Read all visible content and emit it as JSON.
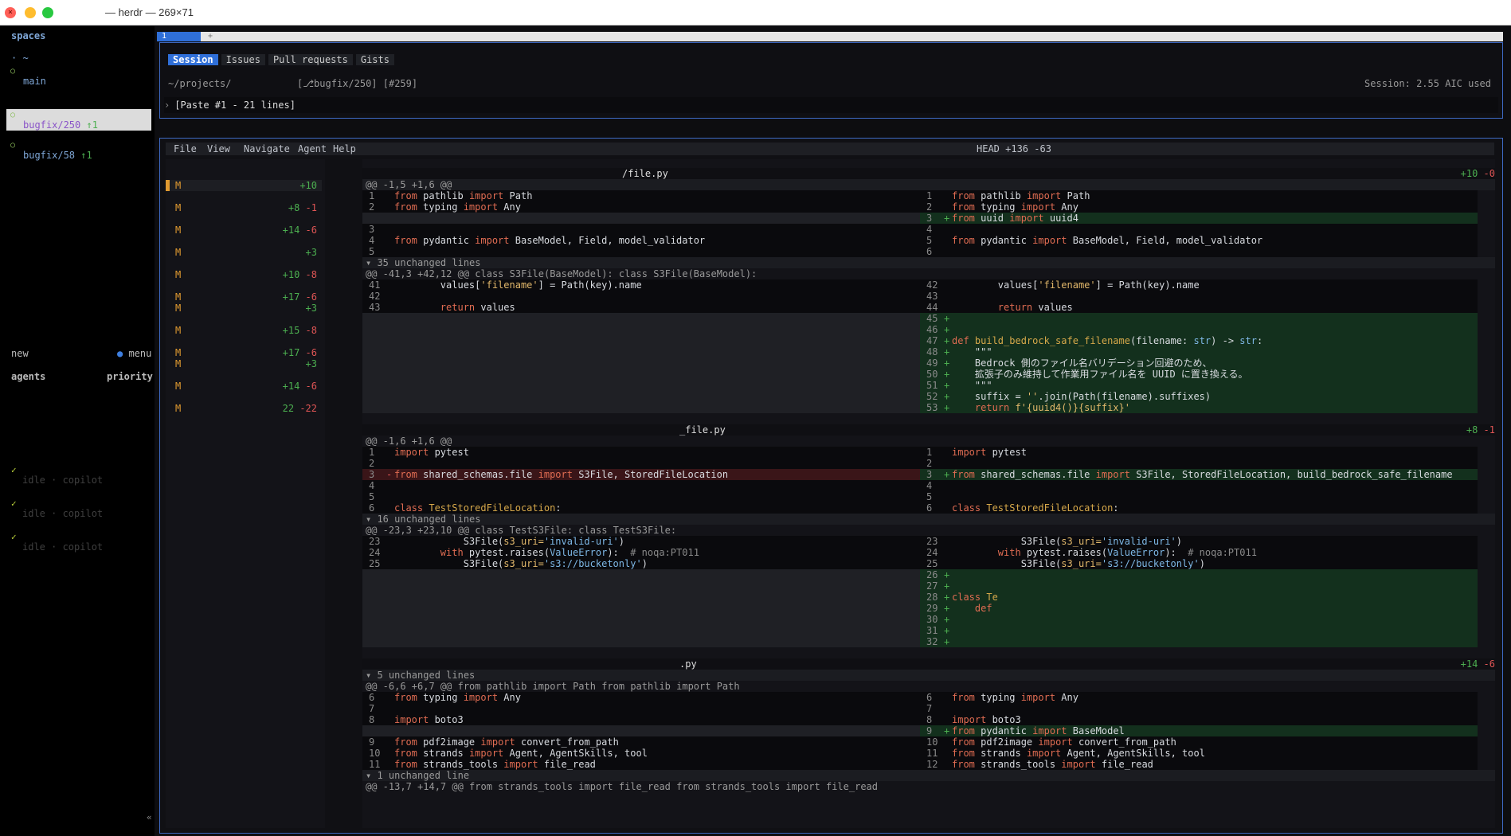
{
  "window": {
    "title": "— herdr — 269×71",
    "close_glyph": "×"
  },
  "sidebar": {
    "spaces_label": "spaces",
    "home": "· ~",
    "circle": "○",
    "items": [
      {
        "name": "main",
        "ahead": ""
      },
      {
        "name": "bugfix/250",
        "ahead": "↑1"
      },
      {
        "name": "bugfix/58",
        "ahead": "↑1"
      }
    ],
    "new_label": "new",
    "menu_label": "● menu",
    "agents_label": "agents",
    "priority_label": "priority",
    "check": "✓",
    "agents": [
      {
        "status": "idle · copilot"
      },
      {
        "status": "idle · copilot"
      },
      {
        "status": "idle · copilot"
      }
    ],
    "collapse": "«"
  },
  "tabs": {
    "active": "1",
    "plus": "+"
  },
  "session": {
    "tabs": [
      "Session",
      "Issues",
      "Pull requests",
      "Gists"
    ],
    "path": "~/projects/",
    "branch": "[⎇bugfix/250] [#259]",
    "usage": "Session: 2.55 AIC used",
    "prompt_marker": "›",
    "prompt": "[Paste #1 - 21 lines]"
  },
  "menu": {
    "items": [
      "File",
      "View",
      "Navigate",
      "Agent",
      "Help"
    ],
    "head": "HEAD  +136  -63"
  },
  "files": [
    {
      "status": "M",
      "add": "+10",
      "del": ""
    },
    {
      "status": "M",
      "add": "+8",
      "del": "-1"
    },
    {
      "status": "M",
      "add": "+14",
      "del": "-6"
    },
    {
      "status": "M",
      "add": "+3",
      "del": ""
    },
    {
      "status": "M",
      "add": "+10",
      "del": "-8"
    },
    {
      "status": "M",
      "add": "+17",
      "del": "-6"
    },
    {
      "status": "M",
      "add": "+3",
      "del": ""
    },
    {
      "status": "M",
      "add": "+15",
      "del": "-8"
    },
    {
      "status": "M",
      "add": "+17",
      "del": "-6"
    },
    {
      "status": "M",
      "add": "+3",
      "del": ""
    },
    {
      "status": "M",
      "add": "+14",
      "del": "-6"
    },
    {
      "status": "M",
      "add": "22",
      "del": "-22"
    }
  ],
  "diff": {
    "file1": {
      "name": "/file.py",
      "add": "+10",
      "del": "-0",
      "hunk1": "@@ -1,5 +1,6 @@",
      "unchanged1": "▾ 35 unchanged lines",
      "hunk2": "@@ -41,3 +42,12 @@ class S3File(BaseModel): class S3File(BaseModel):"
    },
    "file2": {
      "name": "_file.py",
      "add": "+8",
      "del": "-1",
      "hunk1": "@@ -1,6 +1,6 @@",
      "unchanged1": "▾ 16 unchanged lines",
      "hunk2": "@@ -23,3 +23,10 @@ class TestS3File: class TestS3File:"
    },
    "file3": {
      "name": ".py",
      "add": "+14",
      "del": "-6",
      "unchanged1": "▾ 5 unchanged lines",
      "hunk1": "@@ -6,6 +6,7 @@ from pathlib import Path from pathlib import Path",
      "unchanged2": "▾ 1 unchanged line",
      "hunk2": "@@ -13,7 +14,7 @@ from strands_tools import file_read from strands_tools import file_read"
    },
    "lines": {
      "l_from": "from",
      "l_import": "import",
      "pathlib": " pathlib ",
      "Path": " Path",
      "typing": " typing ",
      "Any": " Any",
      "uuid": " uuid ",
      "uuid4": " uuid4",
      "pydantic": " pydantic ",
      "pyd_names": " BaseModel, Field, model_validator",
      "values_fn": "        values[",
      "filename_key": "'filename'",
      "values_rhs": "] = Path(key).name",
      "ret": "        return",
      " values": " values",
      "def": "def",
      "bbsf": " build_bedrock_safe_filename",
      "sig_a": "(filename: ",
      "str1": "str",
      "sig_b": ") -> ",
      "str2": "str",
      ":": ":",
      "doc": "    \"\"\"",
      "jp1": "    Bedrock 側のファイル名バリデーション回避のため、",
      "jp2": "    拡張子のみ維持して作業用ファイル名を UUID に置き換える。",
      "suffix_a": "    suffix = ",
      "suffix_s": "''",
      "suffix_b": ".join(Path(filename).suffixes)",
      "ret_f": "    return",
      "ret_fs": " f'{uuid4()}{suffix}'",
      "pytest": " pytest",
      "shared": " shared_schemas.file ",
      "shared_names": " S3File, StoredFileLocation",
      "shared_names2": " S3File, StoredFileLocation, build_bedrock_safe_filename",
      "class": "class",
      "tsfl": " TestStoredFileLocation",
      "s3_a": "            S3File(",
      "s3_kw": "s3_uri=",
      "s3_inv": "'invalid-uri'",
      "s3_close": ")",
      "with_a": "        ",
      "with": "with",
      " pyr": " pytest.raises(",
      "ve": "ValueError",
      "pyr_b": "):  ",
      "noqa": "# noqa:PT011",
      "s3_bucket": "'s3://bucketonly'",
      "class_te": " Te",
      "def_t": "    def ",
      "boto3": " boto3",
      "pdf2image": " pdf2image ",
      "cfp": " convert_from_path",
      "strands": " strands ",
      "strands_names": " Agent, AgentSkills, tool",
      "strands_tools": " strands_tools ",
      "file_read": " file_read",
      "pyd_bm": " BaseModel"
    }
  }
}
